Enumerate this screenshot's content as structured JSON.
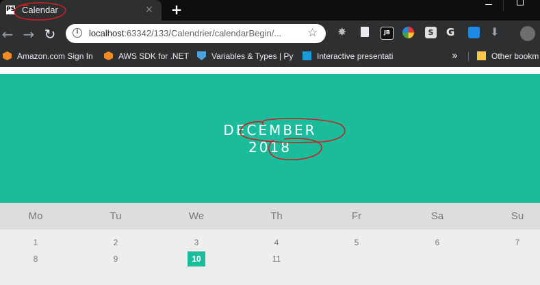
{
  "browser": {
    "tab_title": "Calendar",
    "favicon_text": "PS",
    "tab_close": "×",
    "new_tab": "+",
    "nav_back": "←",
    "nav_forward": "→",
    "nav_reload": "↻",
    "url_host": "localhost",
    "url_rest": ":63342/133/Calendrier/calendarBegin/...",
    "star": "☆",
    "ext_jb": "JB",
    "ext_s": "S",
    "ext_g": "G",
    "ext_down": "⬇"
  },
  "bookmarks": [
    {
      "label": "Amazon.com Sign In"
    },
    {
      "label": "AWS SDK for .NET"
    },
    {
      "label": "Variables & Types | Py"
    },
    {
      "label": "Interactive presentati"
    },
    {
      "label": "Other bookm"
    }
  ],
  "bookmarks_more": "»",
  "calendar": {
    "month": "DECEMBER",
    "year": "2018",
    "weekdays": [
      "Mo",
      "Tu",
      "We",
      "Th",
      "Fr",
      "Sa",
      "Su"
    ],
    "days": [
      "1",
      "2",
      "3",
      "4",
      "5",
      "6",
      "7",
      "8",
      "9",
      "10",
      "11"
    ],
    "active_day": "10",
    "accent_color": "#1abc9c"
  },
  "annotation_color": "#cc1f1f"
}
